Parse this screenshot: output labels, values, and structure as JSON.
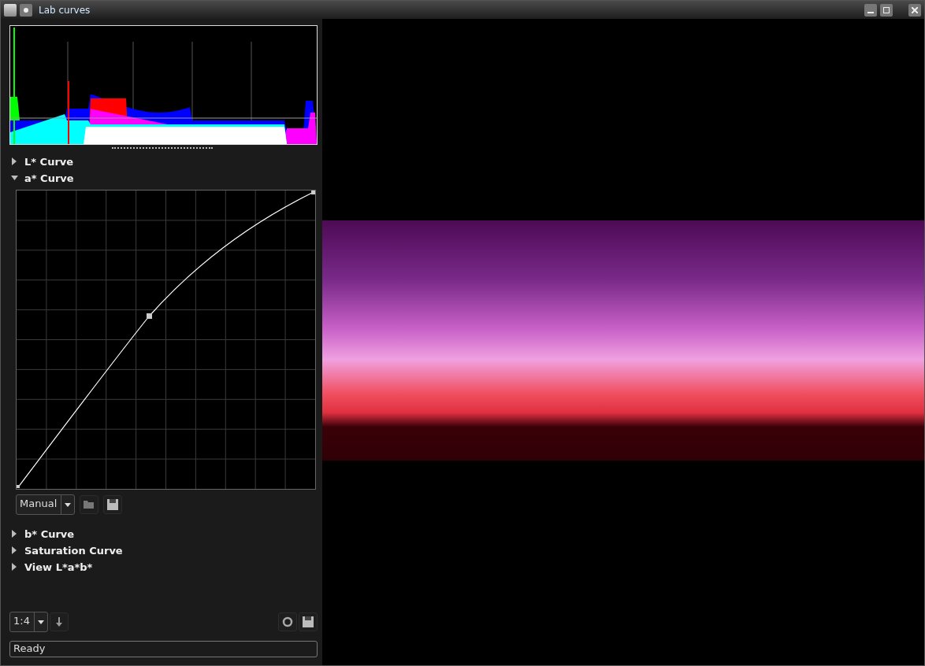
{
  "window": {
    "title": "Lab curves"
  },
  "sections": [
    {
      "label": "L* Curve",
      "expanded": false
    },
    {
      "label": "a* Curve",
      "expanded": true
    },
    {
      "label": "b* Curve",
      "expanded": false
    },
    {
      "label": "Saturation Curve",
      "expanded": false
    },
    {
      "label": "View L*a*b*",
      "expanded": false
    }
  ],
  "curve_editor": {
    "mode": "Manual"
  },
  "zoom": {
    "value": "1:4"
  },
  "status_bar": "Ready"
}
